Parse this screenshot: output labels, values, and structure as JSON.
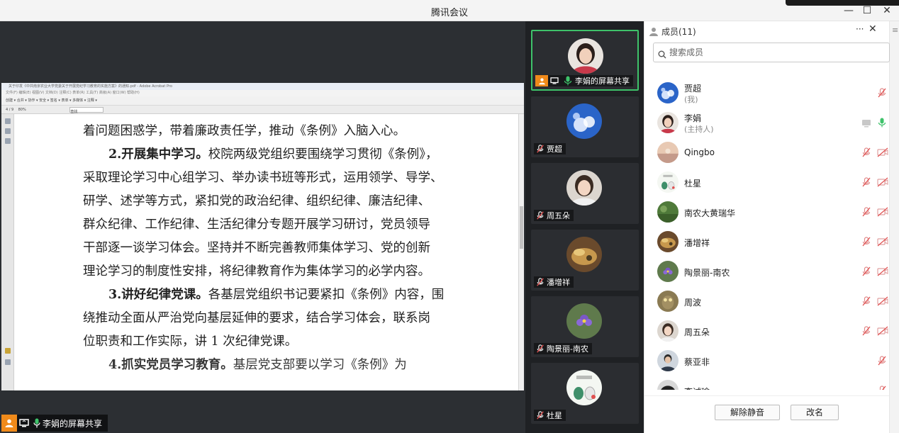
{
  "window": {
    "title": "腾讯会议",
    "minimize": "—",
    "maximize": "☐",
    "close": "✕"
  },
  "shared": {
    "acrobat_title": "关于印发《中共南京农业大学党委关于开展党纪学习教育的实施方案》的通知.pdf - Adobe Acrobat Pro",
    "acrobat_menu": "文件(F)   编辑(E)   视图(V)   文档(D)   注释(C)   表单(R)   工具(T)   高级(A)   窗口(W)   帮助(H)",
    "acrobat_toolbar": "创建 ▾    合并 ▾    协作 ▾    安全 ▾    签名 ▾    表单 ▾    多媒体 ▾    注释 ▾",
    "acrobat_zoom": "80%",
    "page_no": "4",
    "page_total": "/ 9",
    "find_label": "查找",
    "lines": [
      {
        "text": "着问题困惑学，带着廉政责任学，推动《条例》入脑入心。"
      },
      {
        "bold": "2.开展集中学习。",
        "text": "校院两级党组织要围绕学习贯彻《条例》，"
      },
      {
        "text": "采取理论学习中心组学习、举办读书班等形式，运用领学、导学、"
      },
      {
        "text": "研学、述学等方式，紧扣党的政治纪律、组织纪律、廉洁纪律、"
      },
      {
        "text": "群众纪律、工作纪律、生活纪律分专题开展学习研讨，党员领导"
      },
      {
        "text": "干部逐一谈学习体会。坚持并不断完善教师集体学习、党的创新"
      },
      {
        "text": "理论学习的制度性安排，将纪律教育作为集体学习的必学内容。"
      },
      {
        "bold": "3.讲好纪律党课。",
        "text": "各基层党组织书记要紧扣《条例》内容，围"
      },
      {
        "text": "绕推动全面从严治党向基层延伸的要求，结合学习体会，联系岗"
      },
      {
        "text": "位职责和工作实际，讲 1 次纪律党课。"
      },
      {
        "bold": "4.抓实党员学习教育。",
        "text": "基层党支部要以学习《条例》为"
      }
    ],
    "sharer_label": "李娟的屏幕共享"
  },
  "video_tiles": [
    {
      "name": "李娟的屏幕共享",
      "active": true,
      "sharing": true,
      "mic_on": true
    },
    {
      "name": "贾超",
      "active": false,
      "sharing": false,
      "mic_on": false
    },
    {
      "name": "周五朵",
      "active": false,
      "sharing": false,
      "mic_on": false
    },
    {
      "name": "潘增祥",
      "active": false,
      "sharing": false,
      "mic_on": false
    },
    {
      "name": "陶景丽-南农",
      "active": false,
      "sharing": false,
      "mic_on": false
    },
    {
      "name": "杜星",
      "active": false,
      "sharing": false,
      "mic_on": false
    }
  ],
  "members_panel": {
    "title": "成员(11)",
    "more": "···",
    "close": "✕",
    "search_placeholder": "搜索成员",
    "members": [
      {
        "name": "贾超",
        "sub": "(我)",
        "mic": "muted",
        "cam": "none"
      },
      {
        "name": "李娟",
        "sub": "(主持人)",
        "mic": "on",
        "cam": "screen"
      },
      {
        "name": "Qingbo",
        "sub": "",
        "mic": "muted",
        "cam": "off"
      },
      {
        "name": "杜星",
        "sub": "",
        "mic": "muted",
        "cam": "off"
      },
      {
        "name": "南农大黄瑞华",
        "sub": "",
        "mic": "muted",
        "cam": "off"
      },
      {
        "name": "潘增祥",
        "sub": "",
        "mic": "muted",
        "cam": "off"
      },
      {
        "name": "陶景丽-南农",
        "sub": "",
        "mic": "muted",
        "cam": "off"
      },
      {
        "name": "周波",
        "sub": "",
        "mic": "muted",
        "cam": "off"
      },
      {
        "name": "周五朵",
        "sub": "",
        "mic": "muted",
        "cam": "off"
      },
      {
        "name": "蔡亚非",
        "sub": "",
        "mic": "muted",
        "cam": "none"
      },
      {
        "name": "李诚瑜",
        "sub": "",
        "mic": "muted",
        "cam": "none"
      }
    ],
    "unmute_button": "解除静音",
    "rename_button": "改名"
  },
  "colors": {
    "accent": "#3ec26a",
    "orange": "#f08a1a",
    "muted_red": "#e05050"
  }
}
